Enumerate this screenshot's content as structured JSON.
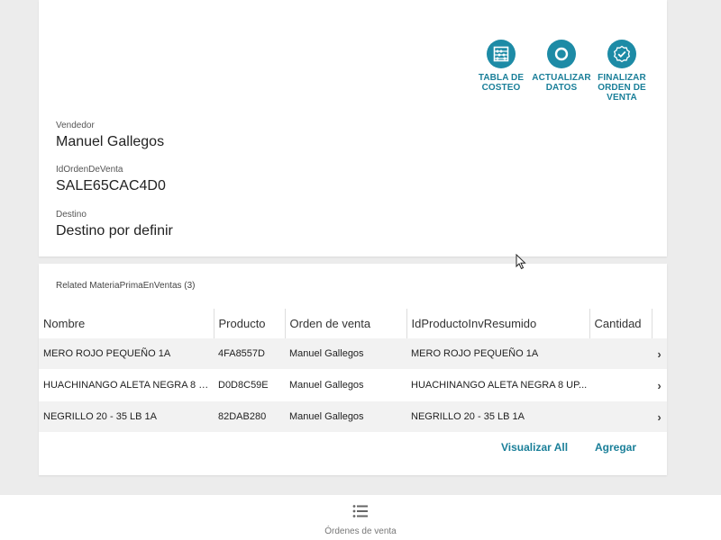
{
  "actions": {
    "tabla_costeo": {
      "line1": "TABLA DE",
      "line2": "COSTEO",
      "icon": "abacus-icon"
    },
    "actualizar_datos": {
      "line1": "ACTUALIZAR",
      "line2": "DATOS",
      "icon": "refresh-circle-icon"
    },
    "finalizar": {
      "line1": "FINALIZAR",
      "line2": "ORDEN DE",
      "line3": "VENTA",
      "icon": "check-badge-icon"
    }
  },
  "fields": {
    "vendedor": {
      "label": "Vendedor",
      "value": "Manuel Gallegos"
    },
    "id_orden": {
      "label": "IdOrdenDeVenta",
      "value": "SALE65CAC4D0"
    },
    "destino": {
      "label": "Destino",
      "value": "Destino por definir"
    }
  },
  "related": {
    "title": "Related MateriaPrimaEnVentas (3)",
    "columns": [
      "Nombre",
      "Producto",
      "Orden de venta",
      "IdProductoInvResumido",
      "Cantidad"
    ],
    "rows": [
      {
        "nombre": "MERO ROJO PEQUEÑO 1A",
        "producto": "4FA8557D",
        "orden": "Manuel Gallegos",
        "id_producto": "MERO ROJO PEQUEÑO 1A",
        "cantidad": ""
      },
      {
        "nombre": "HUACHINANGO ALETA NEGRA 8 U...",
        "producto": "D0D8C59E",
        "orden": "Manuel Gallegos",
        "id_producto": "HUACHINANGO ALETA NEGRA 8 UP...",
        "cantidad": ""
      },
      {
        "nombre": "NEGRILLO 20 - 35 LB 1A",
        "producto": "82DAB280",
        "orden": "Manuel Gallegos",
        "id_producto": "NEGRILLO 20 - 35 LB 1A",
        "cantidad": ""
      }
    ],
    "visualizar_all": "Visualizar All",
    "agregar": "Agregar"
  },
  "bottom_nav": {
    "label": "Órdenes de venta",
    "icon": "list-icon"
  },
  "colors": {
    "accent": "#1d8ba6",
    "accent_text": "#1a7f99"
  }
}
